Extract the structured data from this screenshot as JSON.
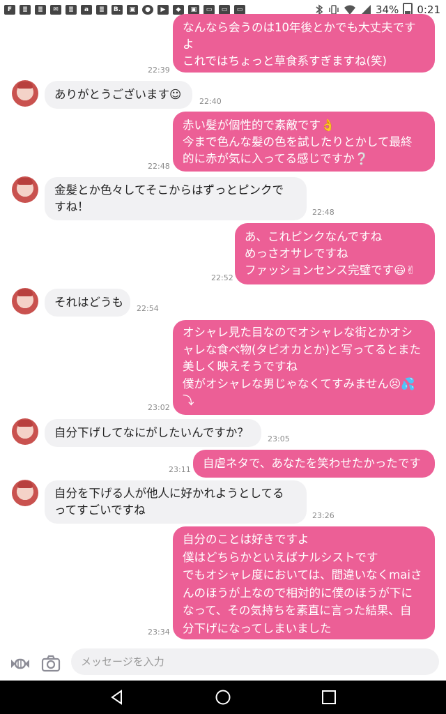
{
  "status_bar": {
    "battery": "34%",
    "time": "0:21",
    "left_icons": [
      "F",
      "≣",
      "≣",
      "✉",
      "≣",
      "a",
      "≣",
      "B.",
      "▣",
      "●",
      "▶",
      "◆",
      "▣",
      "▭",
      "▭",
      "▭"
    ]
  },
  "messages": [
    {
      "side": "out",
      "text": "なんなら会うのは10年後とかでも大丈夫です\nよ\nこれではちょっと草食系すぎますね(笑)",
      "time": "22:39"
    },
    {
      "side": "in",
      "text": "ありがとうございます☺",
      "time": "22:40"
    },
    {
      "side": "out",
      "text": "赤い髪が個性的で素敵です👌\n今まで色んな髪の色を試したりとかして最終\n的に赤が気に入ってる感じですか❔",
      "time": "22:48"
    },
    {
      "side": "in",
      "text": "金髪とか色々してそこからはずっとピンクで\nすね！",
      "time": "22:48"
    },
    {
      "side": "out",
      "text": "あ、これピンクなんですね\nめっさオサレですね\nファッションセンス完璧です😃✌",
      "time": "22:52"
    },
    {
      "side": "in",
      "text": "それはどうも",
      "time": "22:54"
    },
    {
      "side": "out",
      "text": "オシャレ見た目なのでオシャレな街とかオシ\nャレな食べ物(タピオカとか)と写ってるとまた\n美しく映えそうですね\n僕がオシャレな男じゃなくてすみません😣💦\n⤵",
      "time": "23:02"
    },
    {
      "side": "in",
      "text": "自分下げしてなにがしたいんですか？",
      "time": "23:05"
    },
    {
      "side": "out",
      "text": "自虐ネタで、あなたを笑わせたかったです",
      "time": "23:11"
    },
    {
      "side": "in",
      "text": "自分を下げる人が他人に好かれようとしてる\nってすごいですね",
      "time": "23:26"
    },
    {
      "side": "out",
      "text": "自分のことは好きですよ\n僕はどちらかといえばナルシストです\nでもオシャレ度においては、間違いなくmaiさ\nんのほうが上なので相対的に僕のほうが下に\nなって、その気持ちを素直に言った結果、自\n分下げになってしまいました",
      "time": "23:34"
    }
  ],
  "input": {
    "placeholder": "メッセージを入力"
  },
  "colors": {
    "outgoing_bubble": "#ec5f96",
    "incoming_bubble": "#f1f1f3",
    "nav_bar": "#000000"
  },
  "icons": {
    "sticker": "candy-icon",
    "camera": "camera-icon",
    "back": "back-triangle-icon",
    "home": "home-circle-icon",
    "recents": "recents-square-icon"
  }
}
